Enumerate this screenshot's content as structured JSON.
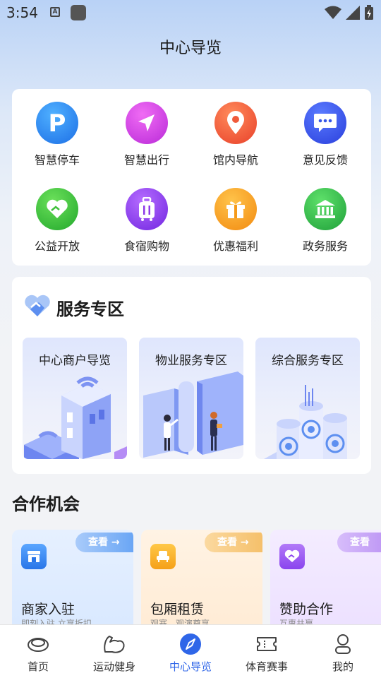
{
  "status_bar": {
    "time": "3:54"
  },
  "header": {
    "title": "中心导览"
  },
  "quick_grid": [
    {
      "label": "智慧停车",
      "icon": "parking-icon",
      "color": "#2b84f0"
    },
    {
      "label": "智慧出行",
      "icon": "navigation-arrow-icon",
      "color": "#d63fe0"
    },
    {
      "label": "馆内导航",
      "icon": "location-pin-icon",
      "color": "#f25a3a"
    },
    {
      "label": "意见反馈",
      "icon": "chat-bubble-icon",
      "color": "#3556e8"
    },
    {
      "label": "公益开放",
      "icon": "heart-hands-icon",
      "color": "#3fbf3a"
    },
    {
      "label": "食宿购物",
      "icon": "luggage-icon",
      "color": "#8d3ae8"
    },
    {
      "label": "优惠福利",
      "icon": "gift-icon",
      "color": "#f59a1a"
    },
    {
      "label": "政务服务",
      "icon": "government-building-icon",
      "color": "#2eb84a"
    }
  ],
  "service_zone": {
    "title": "服务专区",
    "tiles": [
      {
        "label": "中心商户导览"
      },
      {
        "label": "物业服务专区"
      },
      {
        "label": "综合服务专区"
      }
    ]
  },
  "cooperation": {
    "title": "合作机会",
    "cards": [
      {
        "name": "商家入驻",
        "subtitle": "即刻入驻 立享折扣",
        "badge": "查看 →",
        "badge_color": "#6aa6f5",
        "bg": "#e3efff"
      },
      {
        "name": "包厢租赁",
        "subtitle": "观赛、观演尊享",
        "badge": "查看 →",
        "badge_color": "#f5c06a",
        "bg": "#fff1e0"
      },
      {
        "name": "赞助合作",
        "subtitle": "互惠共赢",
        "badge": "查看",
        "badge_color": "#c09af5",
        "bg": "#f3eaff"
      }
    ]
  },
  "tabbar": {
    "items": [
      {
        "label": "首页",
        "icon": "home-disc-icon"
      },
      {
        "label": "运动健身",
        "icon": "muscle-arm-icon"
      },
      {
        "label": "中心导览",
        "icon": "compass-icon",
        "active": true
      },
      {
        "label": "体育赛事",
        "icon": "ticket-icon"
      },
      {
        "label": "我的",
        "icon": "user-icon"
      }
    ]
  }
}
